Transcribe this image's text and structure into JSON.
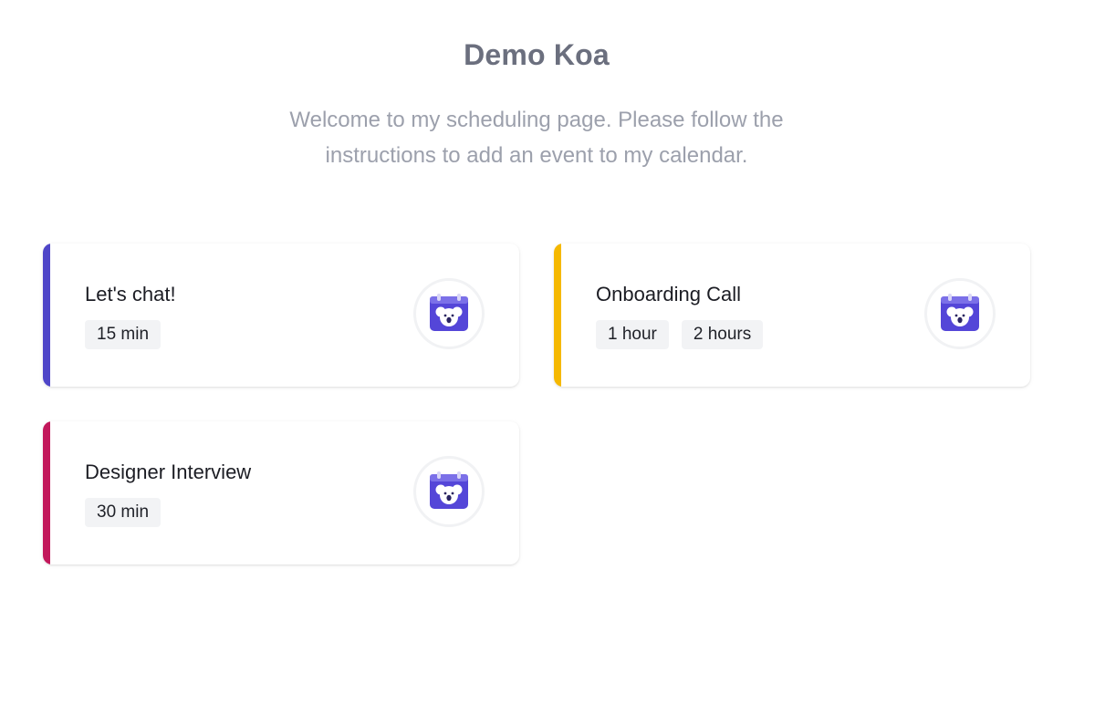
{
  "header": {
    "title": "Demo Koa",
    "subtitle": "Welcome to my scheduling page. Please follow the instructions to add an event to my calendar."
  },
  "colors": {
    "accent_chat": "#4f46c8",
    "accent_onboarding": "#f5b800",
    "accent_interview": "#c2185b",
    "icon_primary": "#5446d8"
  },
  "events": [
    {
      "title": "Let's chat!",
      "durations": [
        "15 min"
      ],
      "icon": "koala-calendar-icon"
    },
    {
      "title": "Onboarding Call",
      "durations": [
        "1 hour",
        "2 hours"
      ],
      "icon": "koala-calendar-icon"
    },
    {
      "title": "Designer Interview",
      "durations": [
        "30 min"
      ],
      "icon": "koala-calendar-icon"
    }
  ]
}
